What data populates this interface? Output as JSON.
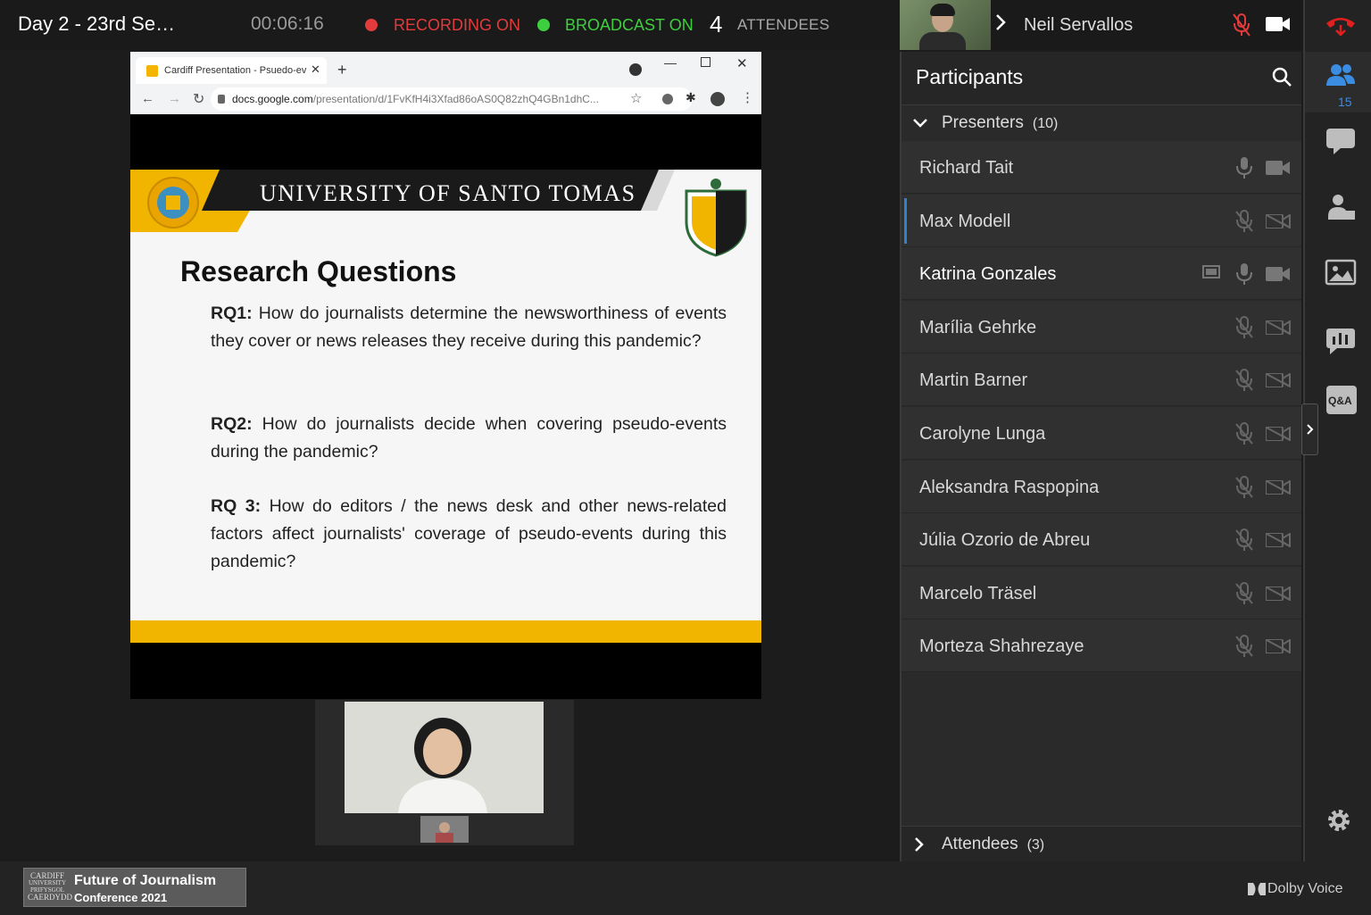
{
  "topbar": {
    "title": "Day 2 - 23rd Se…",
    "timer": "00:06:16",
    "recording": "RECORDING ON",
    "broadcast": "BROADCAST ON",
    "attendee_count": "4",
    "attendees_label": "ATTENDEES",
    "self_name": "Neil Servallos",
    "colors": {
      "recording": "#e23b3b",
      "broadcast": "#3ecf3e",
      "hangup": "#e02020"
    }
  },
  "rail": {
    "participants_count": "15",
    "qa_label": "Q&A"
  },
  "panel": {
    "title": "Participants",
    "presenters_label": "Presenters",
    "presenters_count": "(10)",
    "presenters": [
      {
        "name": "Richard Tait"
      },
      {
        "name": "Max Modell"
      },
      {
        "name": "Katrina Gonzales"
      },
      {
        "name": "Marília Gehrke"
      },
      {
        "name": "Martin Barner"
      },
      {
        "name": "Carolyne Lunga"
      },
      {
        "name": "Aleksandra Raspopina"
      },
      {
        "name": "Júlia Ozorio de Abreu"
      },
      {
        "name": "Marcelo Träsel"
      },
      {
        "name": "Morteza Shahrezaye"
      }
    ],
    "attendees_label": "Attendees",
    "attendees_count": "(3)"
  },
  "browser": {
    "tab_title": "Cardiff Presentation - Psuedo-ev",
    "url_domain": "docs.google.com",
    "url_path": "/presentation/d/1FvKfH4i3Xfad86oAS0Q82zhQ4GBn1dhC..."
  },
  "slide": {
    "university": "UNIVERSITY OF SANTO TOMAS",
    "title": "Research Questions",
    "rq1_label": "RQ1:",
    "rq1_text": "How do journalists determine the newsworthiness of events they cover or news releases they receive during this pandemic?",
    "rq2_label": "RQ2:",
    "rq2_text": "How do journalists decide when covering pseudo-events during the pandemic?",
    "rq3_label": "RQ 3:",
    "rq3_text": "How do editors / the news desk and other news-related factors affect journalists' coverage of pseudo-events during this pandemic?"
  },
  "bottombar": {
    "conf_line1": "Future of Journalism",
    "conf_line2": "Conference 2021",
    "cardiff_line1": "CARDIFF",
    "cardiff_line2": "UNIVERSITY",
    "cardiff_line3": "PRIFYSGOL",
    "cardiff_line4": "CAERDYDD",
    "brand": "Dolby Voice"
  }
}
